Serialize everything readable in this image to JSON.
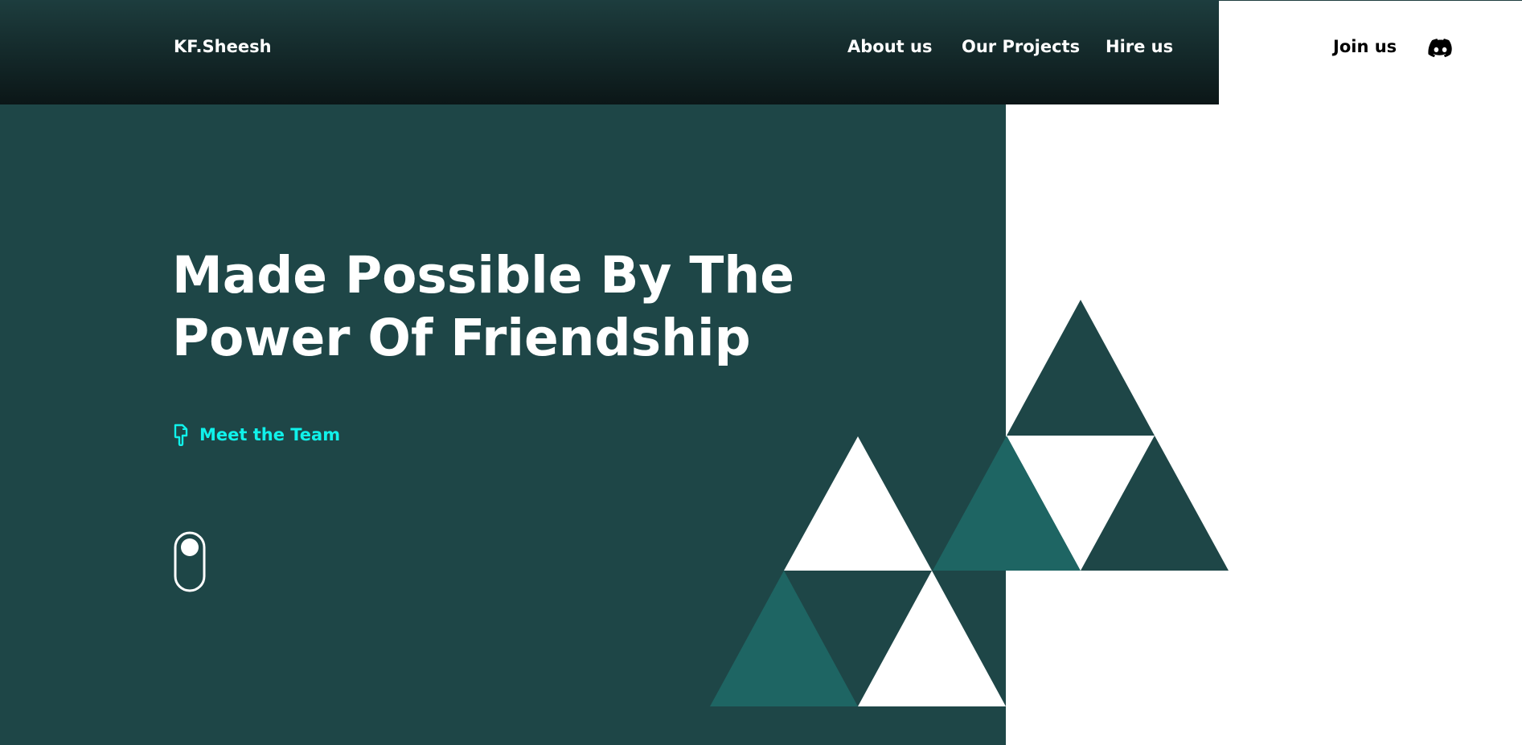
{
  "brand": {
    "logo_text": "KF.Sheesh"
  },
  "nav": {
    "about": "About us",
    "projects": "Our Projects",
    "hire": "Hire us",
    "join": "Join us",
    "discord_icon": "discord-icon"
  },
  "hero": {
    "headline_line1": "Made Possible By The",
    "headline_line2": "Power Of Friendship",
    "cta_label": "Meet the Team",
    "cta_icon": "pointing-hand-down-icon",
    "scroll_icon": "scroll-mouse-icon"
  },
  "colors": {
    "hero_background": "#1e4647",
    "header_gradient_top": "#1d3d3e",
    "header_gradient_bottom": "#0b1617",
    "accent_cyan": "#10f1ea",
    "triangle_dark": "#1e4647",
    "triangle_teal": "#1e6563",
    "triangle_white": "#ffffff"
  }
}
